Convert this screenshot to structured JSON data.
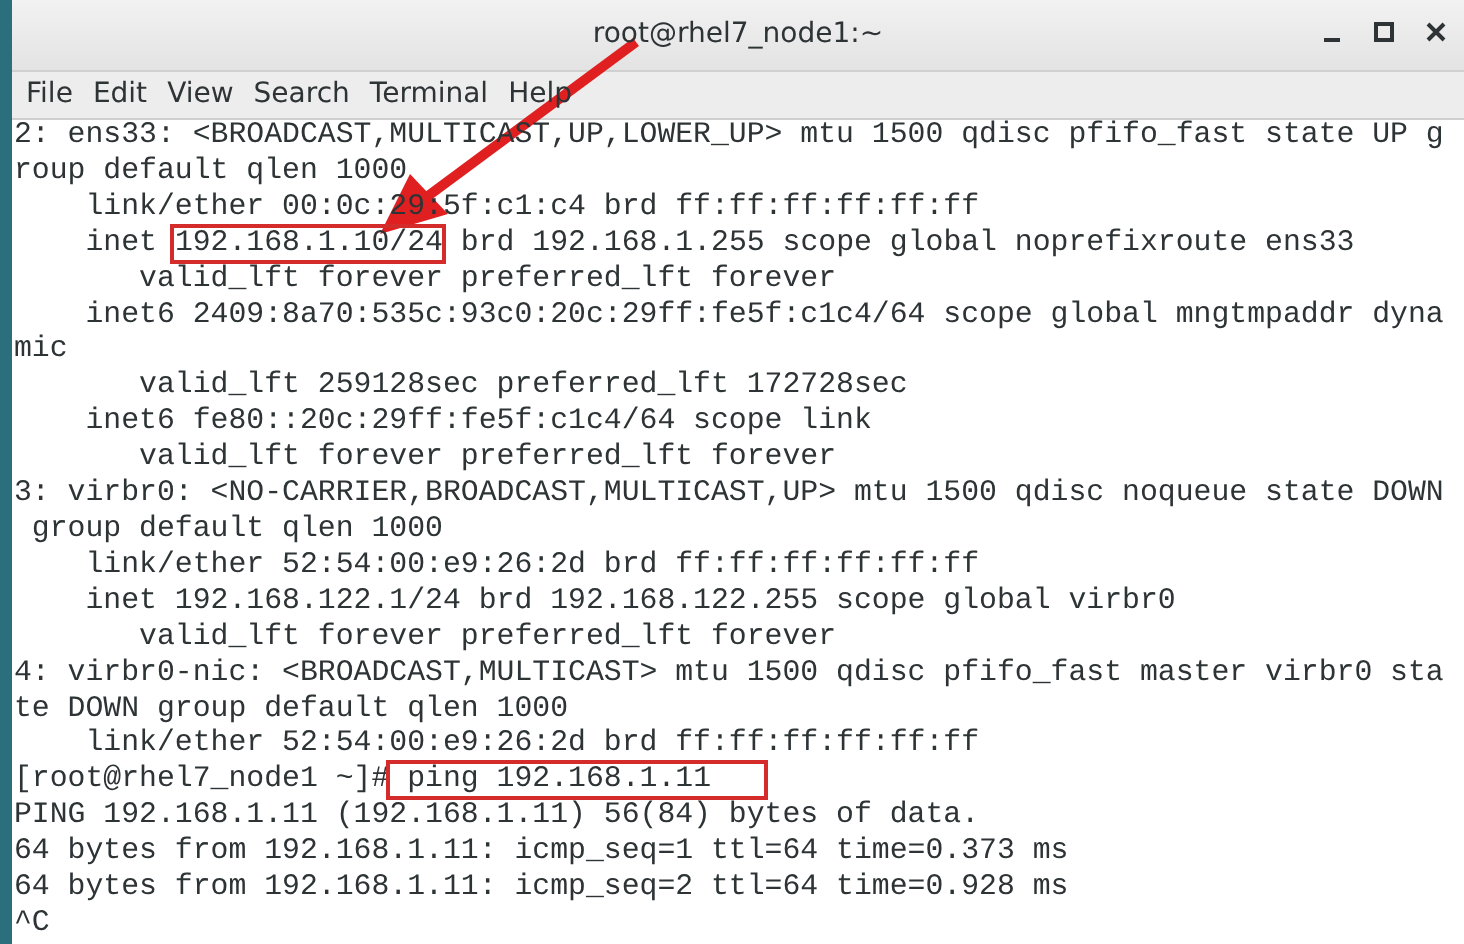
{
  "window": {
    "title": "root@rhel7_node1:~"
  },
  "menu": [
    "File",
    "Edit",
    "View",
    "Search",
    "Terminal",
    "Help"
  ],
  "terminal": {
    "lines": [
      {
        "parts": [
          {
            "text": "2: ens33: <BROADCAST,MULTICAST,UP,LOWER_UP> mtu 1500 qdisc pfifo_fast state UP g",
            "boxed": false
          }
        ]
      },
      {
        "parts": [
          {
            "text": "roup default qlen 1000",
            "boxed": false
          }
        ]
      },
      {
        "parts": [
          {
            "text": "    link/ether 00:0c:29:5f:c1:c4 brd ff:ff:ff:ff:ff:ff",
            "boxed": false
          }
        ]
      },
      {
        "parts": [
          {
            "text": "    inet ",
            "boxed": false
          },
          {
            "text": "192.168.1.10/24",
            "boxed": true
          },
          {
            "text": " brd 192.168.1.255 scope global noprefixroute ens33",
            "boxed": false
          }
        ]
      },
      {
        "parts": [
          {
            "text": "       valid_lft forever preferred_lft forever",
            "boxed": false
          }
        ]
      },
      {
        "parts": [
          {
            "text": "    inet6 2409:8a70:535c:93c0:20c:29ff:fe5f:c1c4/64 scope global mngtmpaddr dyna",
            "boxed": false
          }
        ]
      },
      {
        "parts": [
          {
            "text": "mic",
            "boxed": false
          }
        ]
      },
      {
        "parts": [
          {
            "text": "       valid_lft 259128sec preferred_lft 172728sec",
            "boxed": false
          }
        ]
      },
      {
        "parts": [
          {
            "text": "    inet6 fe80::20c:29ff:fe5f:c1c4/64 scope link",
            "boxed": false
          }
        ]
      },
      {
        "parts": [
          {
            "text": "       valid_lft forever preferred_lft forever",
            "boxed": false
          }
        ]
      },
      {
        "parts": [
          {
            "text": "3: virbr0: <NO-CARRIER,BROADCAST,MULTICAST,UP> mtu 1500 qdisc noqueue state DOWN",
            "boxed": false
          }
        ]
      },
      {
        "parts": [
          {
            "text": " group default qlen 1000",
            "boxed": false
          }
        ]
      },
      {
        "parts": [
          {
            "text": "    link/ether 52:54:00:e9:26:2d brd ff:ff:ff:ff:ff:ff",
            "boxed": false
          }
        ]
      },
      {
        "parts": [
          {
            "text": "    inet 192.168.122.1/24 brd 192.168.122.255 scope global virbr0",
            "boxed": false
          }
        ]
      },
      {
        "parts": [
          {
            "text": "       valid_lft forever preferred_lft forever",
            "boxed": false
          }
        ]
      },
      {
        "parts": [
          {
            "text": "4: virbr0-nic: <BROADCAST,MULTICAST> mtu 1500 qdisc pfifo_fast master virbr0 sta",
            "boxed": false
          }
        ]
      },
      {
        "parts": [
          {
            "text": "te DOWN group default qlen 1000",
            "boxed": false
          }
        ]
      },
      {
        "parts": [
          {
            "text": "    link/ether 52:54:00:e9:26:2d brd ff:ff:ff:ff:ff:ff",
            "boxed": false
          }
        ]
      },
      {
        "parts": [
          {
            "text": "[root@rhel7_node1 ~]#",
            "boxed": false
          },
          {
            "text": " ping 192.168.1.11   ",
            "boxed": true
          }
        ]
      },
      {
        "parts": [
          {
            "text": "PING 192.168.1.11 (192.168.1.11) 56(84) bytes of data.",
            "boxed": false
          }
        ]
      },
      {
        "parts": [
          {
            "text": "64 bytes from 192.168.1.11: icmp_seq=1 ttl=64 time=0.373 ms",
            "boxed": false
          }
        ]
      },
      {
        "parts": [
          {
            "text": "64 bytes from 192.168.1.11: icmp_seq=2 ttl=64 time=0.928 ms",
            "boxed": false
          }
        ]
      },
      {
        "parts": [
          {
            "text": "^C",
            "boxed": false
          }
        ]
      }
    ]
  }
}
